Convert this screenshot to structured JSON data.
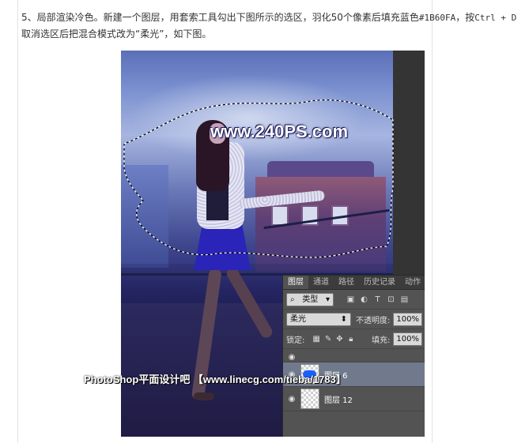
{
  "article": {
    "text_before_code": "5、局部渲染冷色。新建一个图层，用套索工具勾出下图所示的选区，羽化50个像素后填充蓝色",
    "color_code": "#1B60FA",
    "text_mid": "，按",
    "shortcut": "Ctrl + D",
    "text_after": " 取消选区后把混合模式改为“柔光”，如下图。"
  },
  "photo": {
    "watermark": "www.240PS.com",
    "credit": "PhotoShop平面设计吧 【www.linecg.com/tieba/1783】"
  },
  "ps_panel": {
    "tabs": [
      "图层",
      "通道",
      "路径",
      "历史记录",
      "动作"
    ],
    "active_tab": "图层",
    "filter_select": "类型",
    "blend_mode": "柔光",
    "opacity_label": "不透明度:",
    "opacity_value": "100%",
    "lock_label": "锁定:",
    "fill_label": "填充:",
    "fill_value": "100%",
    "layers": [
      {
        "name": "图层 6",
        "selected": true,
        "thumb_color": "#1b60fa"
      },
      {
        "name": "图层 12",
        "selected": false
      }
    ]
  }
}
